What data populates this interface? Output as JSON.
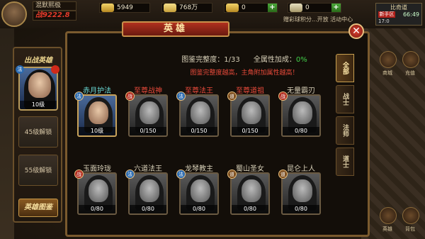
{
  "player": {
    "name": "混默熙极",
    "power": "战9222.8",
    "level_tag": "人物"
  },
  "currency": {
    "gold": "5949",
    "silver": "768万",
    "yuanbao": "0",
    "bound_yuanbao": "0",
    "plus": "+"
  },
  "map": {
    "name": "比奇道",
    "zone": "新手区",
    "time": "66:49",
    "time2": "17:0"
  },
  "ticker": "赠彩球积分...开放 活动中心",
  "left_panel": {
    "title": "出战英雄",
    "hero_level": "10级",
    "slot2": "45级解锁",
    "slot3": "55级解锁",
    "gallery_btn": "英雄图鉴",
    "badge_class": "法"
  },
  "dialog": {
    "title": "英雄",
    "close": "✕",
    "completion_label": "图鉴完整度：",
    "completion_value": "1/33",
    "bonus_label": "全属性加成：",
    "bonus_value": "0%",
    "hint": "图鉴完整度越高，主角附加属性越高！"
  },
  "tabs": [
    {
      "label": "全部",
      "active": true
    },
    {
      "label": "战士",
      "active": false
    },
    {
      "label": "法师",
      "active": false
    },
    {
      "label": "道士",
      "active": false
    }
  ],
  "heroes": [
    {
      "name": "赤月护法",
      "progress": "10级",
      "badge": "法",
      "badge_color": "#2a6ab0",
      "owned": true
    },
    {
      "name": "至尊战神",
      "progress": "0/150",
      "badge": "战",
      "badge_color": "#b02a1e",
      "owned": false
    },
    {
      "name": "至尊法王",
      "progress": "0/150",
      "badge": "法",
      "badge_color": "#2a6ab0",
      "owned": false
    },
    {
      "name": "至尊道祖",
      "progress": "0/150",
      "badge": "道",
      "badge_color": "#7a4a1a",
      "owned": false
    },
    {
      "name": "无量霸刃",
      "progress": "0/80",
      "badge": "战",
      "badge_color": "#b02a1e",
      "owned": false
    },
    {
      "name": "玉面玲珑",
      "progress": "0/80",
      "badge": "战",
      "badge_color": "#b02a1e",
      "owned": false
    },
    {
      "name": "六道法王",
      "progress": "0/80",
      "badge": "法",
      "badge_color": "#2a6ab0",
      "owned": false
    },
    {
      "name": "龙琴教主",
      "progress": "0/80",
      "badge": "法",
      "badge_color": "#2a6ab0",
      "owned": false
    },
    {
      "name": "蜀山圣女",
      "progress": "0/80",
      "badge": "道",
      "badge_color": "#7a4a1a",
      "owned": false
    },
    {
      "name": "昆仑上人",
      "progress": "0/80",
      "badge": "道",
      "badge_color": "#7a4a1a",
      "owned": false
    }
  ],
  "side_labels": {
    "a": "商城",
    "b": "充值",
    "c": "英雄",
    "d": "背包"
  }
}
